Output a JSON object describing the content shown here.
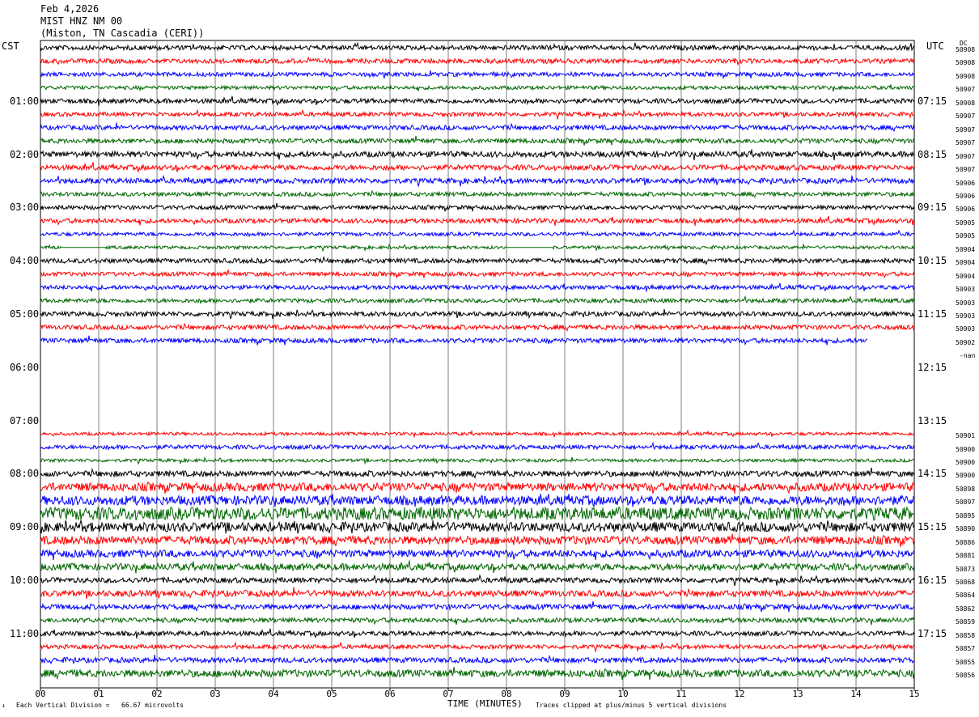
{
  "header": {
    "date": "Feb 4,2026",
    "channel": "MIST HNZ NM 00",
    "station": "(Miston, TN Cascadia (CERI))"
  },
  "left_tz": "CST",
  "right_tz": "UTC",
  "dc_header": "DC",
  "footer": {
    "mark": "↓",
    "division": "Each Vertical Division =   66.67 microvolts",
    "xlabel": "TIME (MINUTES)",
    "clip": "Traces clipped at plus/minus 5 vertical divisions"
  },
  "colors": {
    "c0": "#000000",
    "c1": "#ff0000",
    "c2": "#0000ff",
    "c3": "#006600",
    "grid": "#7f7f7f"
  },
  "chart_data": {
    "type": "line",
    "title": "MIST HNZ NM 00",
    "xlabel": "TIME (MINUTES)",
    "xlim": [
      0,
      15
    ],
    "x_ticks": [
      "00",
      "01",
      "02",
      "03",
      "04",
      "05",
      "06",
      "07",
      "08",
      "09",
      "10",
      "11",
      "12",
      "13",
      "14",
      "15"
    ],
    "left_hour_labels": [
      {
        "row": 4,
        "label": "01:00"
      },
      {
        "row": 8,
        "label": "02:00"
      },
      {
        "row": 12,
        "label": "03:00"
      },
      {
        "row": 16,
        "label": "04:00"
      },
      {
        "row": 20,
        "label": "05:00"
      },
      {
        "row": 24,
        "label": "06:00"
      },
      {
        "row": 28,
        "label": "07:00"
      },
      {
        "row": 32,
        "label": "08:00"
      },
      {
        "row": 36,
        "label": "09:00"
      },
      {
        "row": 40,
        "label": "10:00"
      },
      {
        "row": 44,
        "label": "11:00"
      }
    ],
    "right_hour_labels": [
      {
        "row": 4,
        "label": "07:15"
      },
      {
        "row": 8,
        "label": "08:15"
      },
      {
        "row": 12,
        "label": "09:15"
      },
      {
        "row": 16,
        "label": "10:15"
      },
      {
        "row": 20,
        "label": "11:15"
      },
      {
        "row": 24,
        "label": "12:15"
      },
      {
        "row": 28,
        "label": "13:15"
      },
      {
        "row": 32,
        "label": "14:15"
      },
      {
        "row": 36,
        "label": "15:15"
      },
      {
        "row": 40,
        "label": "16:15"
      },
      {
        "row": 44,
        "label": "17:15"
      }
    ],
    "rows": [
      {
        "dc": "50908",
        "amp": 0.9
      },
      {
        "dc": "50908",
        "amp": 0.9
      },
      {
        "dc": "50908",
        "amp": 0.8
      },
      {
        "dc": "50907",
        "amp": 0.7
      },
      {
        "dc": "50908",
        "amp": 0.9
      },
      {
        "dc": "50907",
        "amp": 0.8
      },
      {
        "dc": "50907",
        "amp": 0.9
      },
      {
        "dc": "50907",
        "amp": 0.9
      },
      {
        "dc": "50907",
        "amp": 1.1
      },
      {
        "dc": "50907",
        "amp": 1.0
      },
      {
        "dc": "50906",
        "amp": 1.0
      },
      {
        "dc": "50906",
        "amp": 0.8
      },
      {
        "dc": "50906",
        "amp": 0.8
      },
      {
        "dc": "50905",
        "amp": 0.9
      },
      {
        "dc": "50905",
        "amp": 0.7
      },
      {
        "dc": "50904",
        "amp": 0.6,
        "gaps": [
          [
            0.35,
            1.1
          ],
          [
            8.0,
            8.8
          ]
        ]
      },
      {
        "dc": "50904",
        "amp": 0.9
      },
      {
        "dc": "50904",
        "amp": 0.8
      },
      {
        "dc": "50903",
        "amp": 0.8
      },
      {
        "dc": "50903",
        "amp": 0.8
      },
      {
        "dc": "50903",
        "amp": 0.9
      },
      {
        "dc": "50903",
        "amp": 0.9
      },
      {
        "dc": "50902",
        "amp": 0.9,
        "end": 14.2
      },
      {
        "dc": "-nan",
        "amp": 0
      },
      {
        "dc": "",
        "amp": 0
      },
      {
        "dc": "",
        "amp": 0
      },
      {
        "dc": "",
        "amp": 0
      },
      {
        "dc": "",
        "amp": 0
      },
      {
        "dc": "",
        "amp": 0
      },
      {
        "dc": "50901",
        "amp": 0.6
      },
      {
        "dc": "50900",
        "amp": 0.8
      },
      {
        "dc": "50900",
        "amp": 0.6
      },
      {
        "dc": "50900",
        "amp": 1.1
      },
      {
        "dc": "50898",
        "amp": 1.6
      },
      {
        "dc": "50897",
        "amp": 1.8
      },
      {
        "dc": "50895",
        "amp": 2.4
      },
      {
        "dc": "50890",
        "amp": 1.8
      },
      {
        "dc": "50886",
        "amp": 1.6
      },
      {
        "dc": "50881",
        "amp": 1.4
      },
      {
        "dc": "50873",
        "amp": 1.3
      },
      {
        "dc": "50868",
        "amp": 1.0
      },
      {
        "dc": "50864",
        "amp": 1.2
      },
      {
        "dc": "50862",
        "amp": 1.0
      },
      {
        "dc": "50859",
        "amp": 0.9
      },
      {
        "dc": "50858",
        "amp": 0.9
      },
      {
        "dc": "50857",
        "amp": 0.8
      },
      {
        "dc": "50855",
        "amp": 1.0
      },
      {
        "dc": "50856",
        "amp": 1.4
      }
    ]
  }
}
